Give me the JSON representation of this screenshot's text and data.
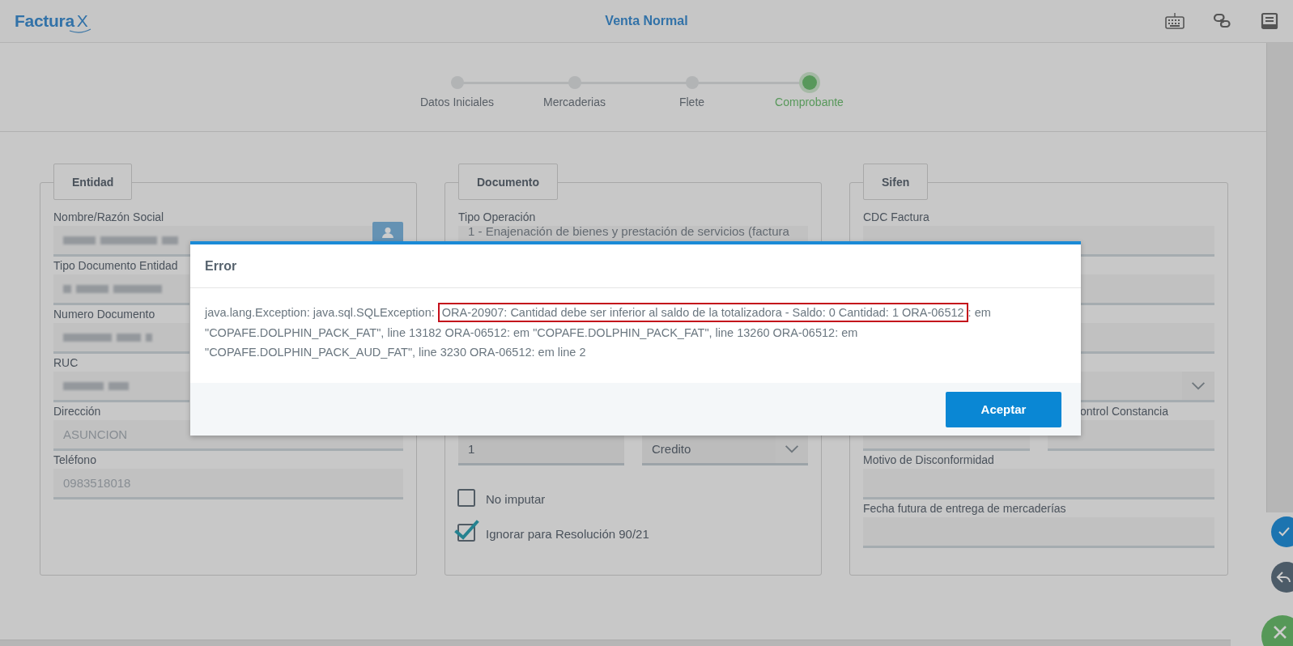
{
  "header": {
    "logo": {
      "text": "Factura",
      "mark": "X"
    },
    "title": "Venta Normal"
  },
  "steps": [
    {
      "label": "Datos Iniciales",
      "selected": false
    },
    {
      "label": "Mercaderias",
      "selected": false
    },
    {
      "label": "Flete",
      "selected": false
    },
    {
      "label": "Comprobante",
      "selected": true
    }
  ],
  "sections": [
    {
      "title": "Entidad",
      "items": [
        {
          "kind": "textfield",
          "label": "Nombre/Razón Social",
          "redacted": true,
          "lookup": true
        },
        {
          "kind": "textfield",
          "label": "Tipo Documento Entidad",
          "redacted": true
        },
        {
          "kind": "textfield",
          "label": "Numero Documento",
          "redacted": true
        },
        {
          "kind": "textfield",
          "label": "RUC",
          "redacted": true
        },
        {
          "kind": "textfield",
          "label": "Dirección",
          "value": "ASUNCION"
        },
        {
          "kind": "textfield",
          "label": "Teléfono",
          "value": "0983518018"
        }
      ]
    },
    {
      "title": "Documento",
      "items": [
        {
          "kind": "textfield",
          "label": "Tipo Operación",
          "value": "1 - Enajenación de bienes y prestación de servicios (factura"
        },
        {
          "kind": "pair",
          "fields": [
            {
              "kind": "textfield",
              "value": "1"
            },
            {
              "kind": "select",
              "value": "Credito"
            }
          ]
        },
        {
          "kind": "checkbox",
          "label": "No imputar",
          "checked": false
        },
        {
          "kind": "checkbox",
          "label": "Ignorar para Resolución 90/21",
          "checked": true
        }
      ]
    },
    {
      "title": "Sifen",
      "items": [
        {
          "kind": "textfield",
          "label": "CDC Factura"
        },
        {
          "kind": "textfield"
        },
        {
          "kind": "textfield"
        },
        {
          "kind": "select"
        },
        {
          "kind": "pair",
          "fields": [
            {
              "kind": "textfield"
            },
            {
              "kind": "textfield",
              "label": "ontrol Constancia"
            }
          ]
        },
        {
          "kind": "textfield",
          "label": "Motivo de Disconformidad"
        },
        {
          "kind": "textfield",
          "label": "Fecha futura de entrega de mercaderías"
        }
      ]
    }
  ],
  "dialog": {
    "title": "Error",
    "message": {
      "before": "java.lang.Exception: java.sql.SQLException: ",
      "highlight": "ORA-20907: Cantidad debe ser inferior al saldo de la totalizadora - Saldo: 0 Cantidad: 1 ORA-06512",
      "after": ": em \"COPAFE.DOLPHIN_PACK_FAT\", line 13182 ORA-06512: em \"COPAFE.DOLPHIN_PACK_FAT\", line 13260 ORA-06512: em \"COPAFE.DOLPHIN_PACK_AUD_FAT\", line 3230 ORA-06512: em line 2"
    },
    "buttons": [
      "Aceptar"
    ]
  }
}
